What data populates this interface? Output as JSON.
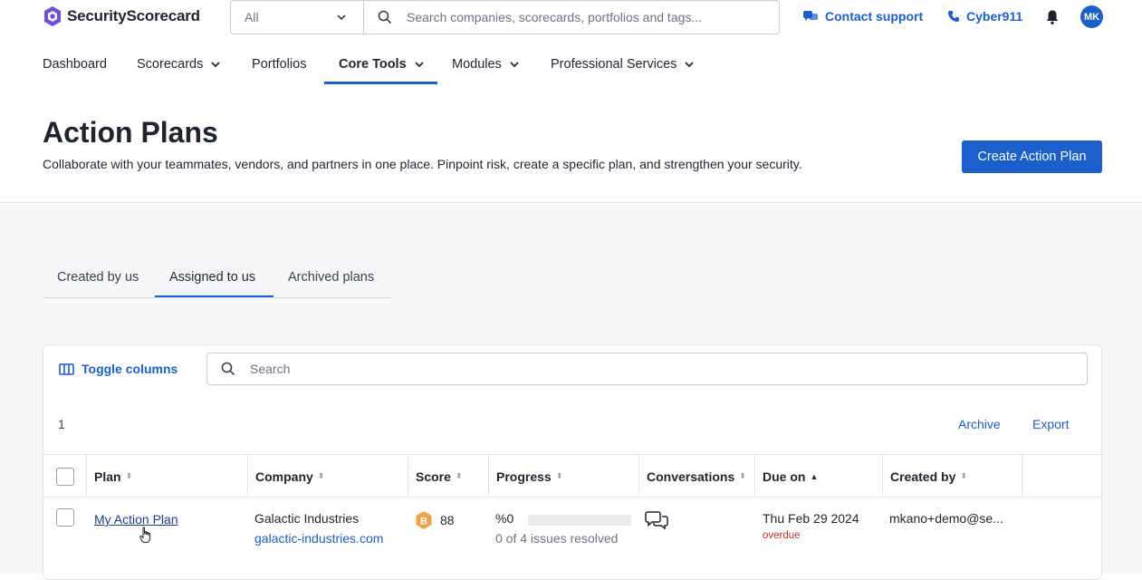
{
  "brand": {
    "name": "SecurityScorecard",
    "accent": "#1a5fcc",
    "logo_color": "#5b3fd6"
  },
  "topbar": {
    "scope_value": "All",
    "search_placeholder": "Search companies, scorecards, portfolios and tags...",
    "contact_support": "Contact support",
    "cyber911": "Cyber911",
    "avatar_initials": "MK"
  },
  "nav": {
    "items": [
      {
        "label": "Dashboard",
        "dropdown": false
      },
      {
        "label": "Scorecards",
        "dropdown": true
      },
      {
        "label": "Portfolios",
        "dropdown": false
      },
      {
        "label": "Core Tools",
        "dropdown": true,
        "active": true
      },
      {
        "label": "Modules",
        "dropdown": true
      },
      {
        "label": "Professional Services",
        "dropdown": true
      }
    ]
  },
  "header": {
    "title": "Action Plans",
    "subtitle": "Collaborate with your teammates, vendors, and partners in one place. Pinpoint risk, create a specific plan, and strengthen your security.",
    "create_button": "Create Action Plan"
  },
  "tabs": [
    {
      "label": "Created by us"
    },
    {
      "label": "Assigned to us",
      "active": true
    },
    {
      "label": "Archived plans"
    }
  ],
  "table": {
    "toggle_columns": "Toggle columns",
    "search_placeholder": "Search",
    "count": "1",
    "archive": "Archive",
    "export": "Export",
    "columns": [
      "Plan",
      "Company",
      "Score",
      "Progress",
      "Conversations",
      "Due on",
      "Created by"
    ],
    "rows": [
      {
        "plan": "My Action Plan",
        "company": "Galactic Industries",
        "domain": "galactic-industries.com",
        "grade": "B",
        "score": "88",
        "progress_pct": "%0",
        "progress_value": 0,
        "progress_detail": "0 of 4 issues resolved",
        "due": "Thu Feb 29 2024",
        "due_status": "overdue",
        "created_by": "mkano+demo@se..."
      }
    ]
  }
}
